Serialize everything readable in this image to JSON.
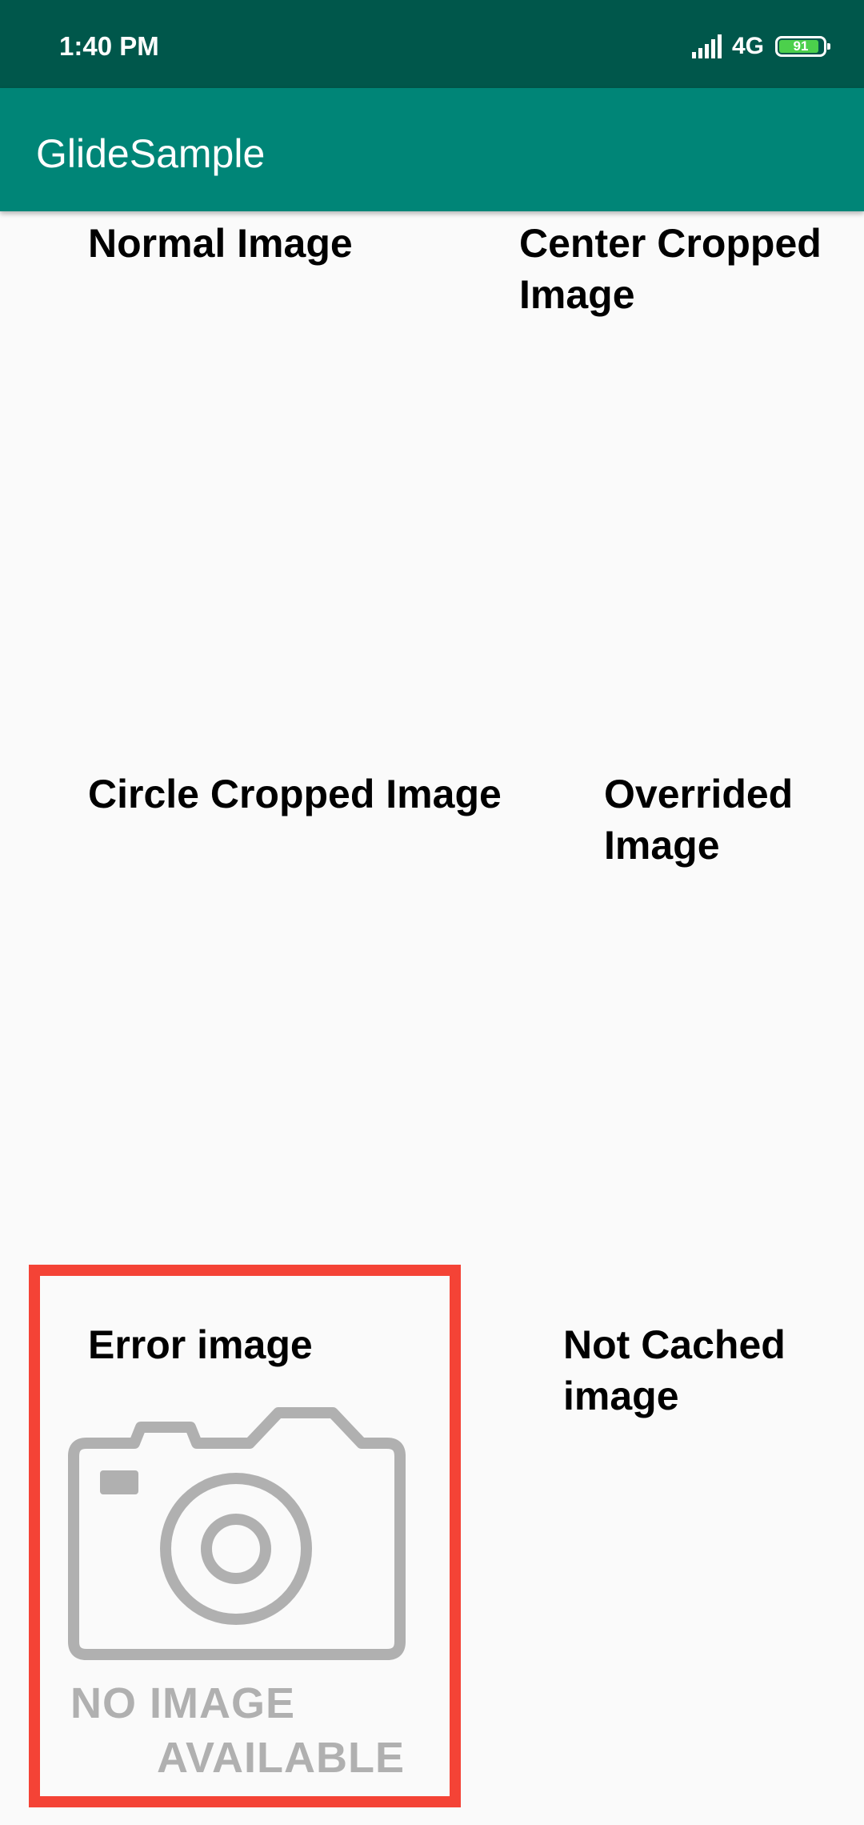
{
  "status_bar": {
    "time": "1:40 PM",
    "network": "4G",
    "battery_level": "91",
    "battery_fraction": 0.91,
    "icons": [
      "signal-icon",
      "battery-icon"
    ]
  },
  "app_bar": {
    "title": "GlideSample"
  },
  "grid": {
    "normal_image_label": "Normal Image",
    "center_cropped_label": "Center Cropped Image",
    "circle_cropped_label": "Circle Cropped Image",
    "overrided_label": "Overrided Image",
    "error_image_label": "Error image",
    "not_cached_label": "Not Cached image"
  },
  "error_placeholder": {
    "icon": "camera-icon",
    "line1": "NO IMAGE",
    "line2": "AVAILABLE",
    "highlight_color": "#f44336"
  },
  "colors": {
    "status_bar": "#00574b",
    "app_bar": "#008577",
    "background": "#fafafa",
    "placeholder_gray": "#b0b0b0"
  }
}
